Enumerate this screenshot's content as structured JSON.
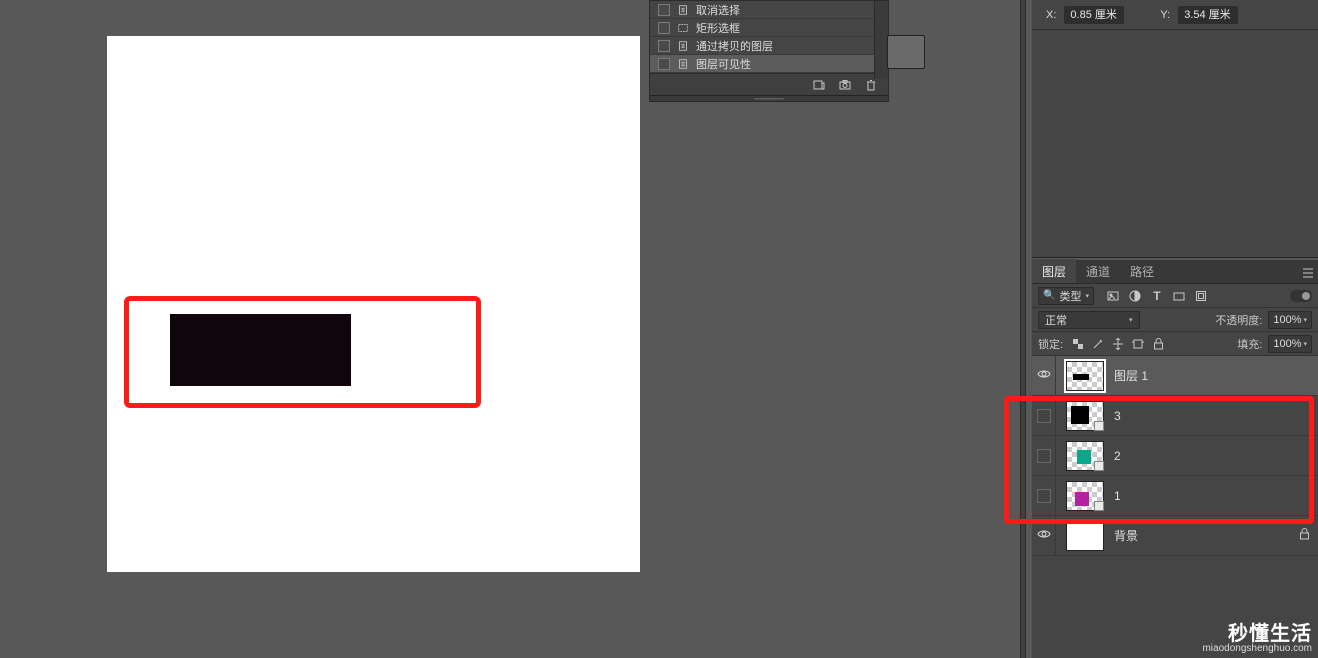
{
  "coords": {
    "x_label": "X:",
    "x_value": "0.85 厘米",
    "y_label": "Y:",
    "y_value": "3.54 厘米"
  },
  "history": {
    "items": [
      {
        "label": "取消选择",
        "icon": "doc"
      },
      {
        "label": "矩形选框",
        "icon": "marquee"
      },
      {
        "label": "通过拷贝的图层",
        "icon": "doc"
      },
      {
        "label": "图层可见性",
        "icon": "doc",
        "selected": true
      }
    ]
  },
  "layers_panel": {
    "tabs": {
      "layers": "图层",
      "channels": "通道",
      "paths": "路径"
    },
    "type_label": "类型",
    "blend_mode": "正常",
    "opacity_label": "不透明度:",
    "opacity_value": "100%",
    "lock_label": "锁定:",
    "fill_label": "填充:",
    "fill_value": "100%",
    "layers": [
      {
        "name": "图层 1",
        "visible": true,
        "selected": true,
        "thumb": "black-bar"
      },
      {
        "name": "3",
        "visible": false,
        "smart": true,
        "thumb": "black-square"
      },
      {
        "name": "2",
        "visible": false,
        "smart": true,
        "thumb": "teal-square"
      },
      {
        "name": "1",
        "visible": false,
        "smart": true,
        "thumb": "magenta-square"
      },
      {
        "name": "背景",
        "visible": true,
        "locked": true,
        "thumb": "white"
      }
    ]
  },
  "watermark": {
    "cn": "秒懂生活",
    "en": "miaodongshenghuo.com"
  }
}
